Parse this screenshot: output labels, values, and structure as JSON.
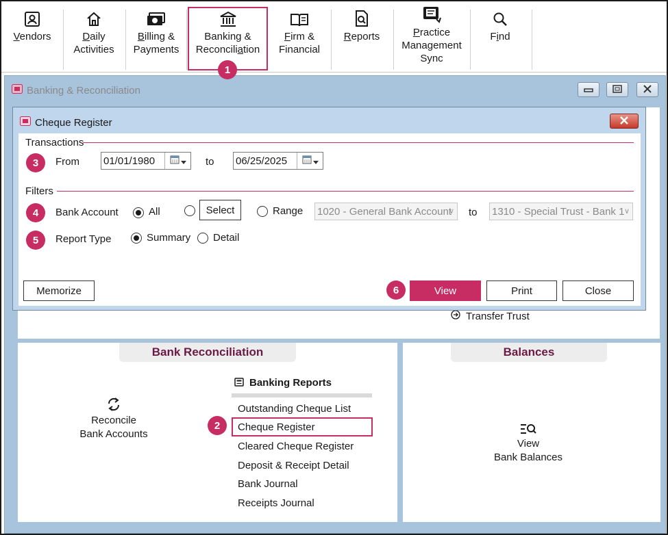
{
  "ribbon": {
    "items": [
      {
        "label_pre": "",
        "label_ul": "V",
        "label_post": "endors",
        "icon": "vendor-id-icon"
      },
      {
        "label_pre": "",
        "label_ul": "D",
        "label_post": "aily\nActivities",
        "icon": "home-icon"
      },
      {
        "label_pre": "",
        "label_ul": "B",
        "label_post": "illing &\nPayments",
        "icon": "money-icon"
      },
      {
        "label_pre": "Banking &\nReconcili",
        "label_ul": "a",
        "label_post": "tion",
        "icon": "bank-icon"
      },
      {
        "label_pre": "",
        "label_ul": "F",
        "label_post": "irm &\nFinancial",
        "icon": "book-icon"
      },
      {
        "label_pre": "",
        "label_ul": "R",
        "label_post": "eports",
        "icon": "report-search-icon"
      },
      {
        "label_pre": "",
        "label_ul": "P",
        "label_post": "ractice\nManagement\nSync",
        "icon": "pm-sync-icon"
      },
      {
        "label_pre": "F",
        "label_ul": "i",
        "label_post": "nd",
        "icon": "magnifier-icon"
      }
    ]
  },
  "main_window": {
    "title": "Banking & Reconciliation",
    "transfer_trust": "Transfer Trust",
    "bank_reconciliation": {
      "header": "Bank Reconciliation",
      "reconcile_line1": "Reconcile",
      "reconcile_line2": "Bank Accounts",
      "reports_header": "Banking Reports",
      "reports": [
        "Outstanding Cheque List",
        "Cheque Register",
        "Cleared Cheque Register",
        "Deposit & Receipt Detail",
        "Bank Journal",
        "Receipts Journal"
      ]
    },
    "balances": {
      "header": "Balances",
      "view_line1": "View",
      "view_line2": "Bank Balances"
    }
  },
  "dialog": {
    "title": "Cheque Register",
    "transactions_label": "Transactions",
    "from_label": "From",
    "from_value": "01/01/1980",
    "to_label": "to",
    "to_value": "06/25/2025",
    "filters_label": "Filters",
    "bank_account_label": "Bank Account",
    "opt_all": "All",
    "select_button": "Select",
    "opt_range": "Range",
    "range_from": "1020 - General Bank Account",
    "range_to_label": "to",
    "range_to": "1310 - Special Trust - Bank 1",
    "report_type_label": "Report Type",
    "opt_summary": "Summary",
    "opt_detail": "Detail",
    "memorize_button": "Memorize",
    "view_button": "View",
    "print_button": "Print",
    "close_button": "Close"
  },
  "callouts": [
    "1",
    "2",
    "3",
    "4",
    "5",
    "6"
  ],
  "colors": {
    "accent": "#c72c62",
    "header_text": "#6b1a45",
    "window_bg": "#a8c3dc"
  }
}
